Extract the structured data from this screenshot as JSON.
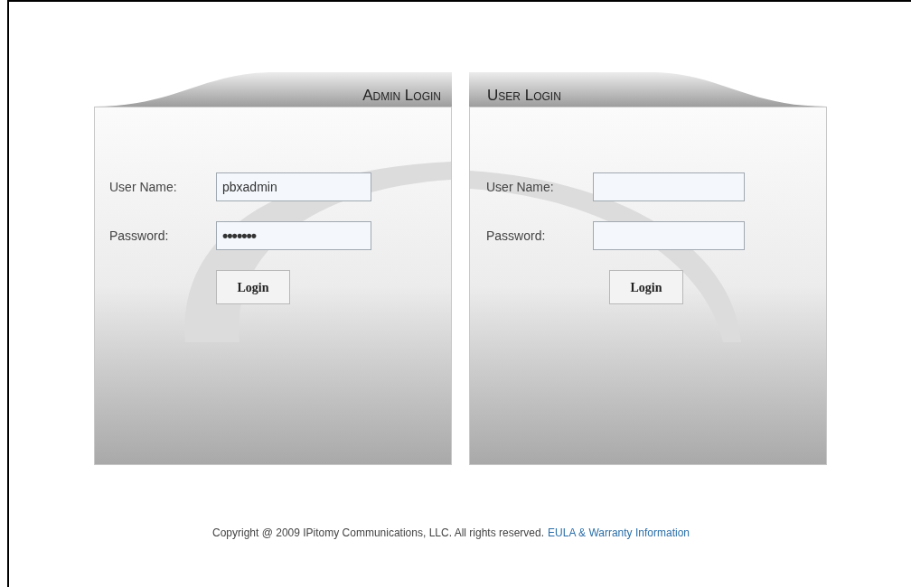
{
  "panels": [
    {
      "kind": "admin",
      "title": "Admin Login",
      "fields": [
        {
          "label": "User Name:",
          "kind": "text",
          "value": "pbxadmin"
        },
        {
          "label": "Password:",
          "kind": "password",
          "value": "•••••••"
        }
      ],
      "button": "Login"
    },
    {
      "kind": "user",
      "title": "User Login",
      "fields": [
        {
          "label": "User Name:",
          "kind": "text"
        },
        {
          "label": "Password:",
          "kind": "password"
        }
      ],
      "button": "Login"
    }
  ],
  "footer": {
    "text": "Copyright @ 2009 IPitomy Communications, LLC. All rights reserved.",
    "link": "EULA & Warranty Information"
  }
}
